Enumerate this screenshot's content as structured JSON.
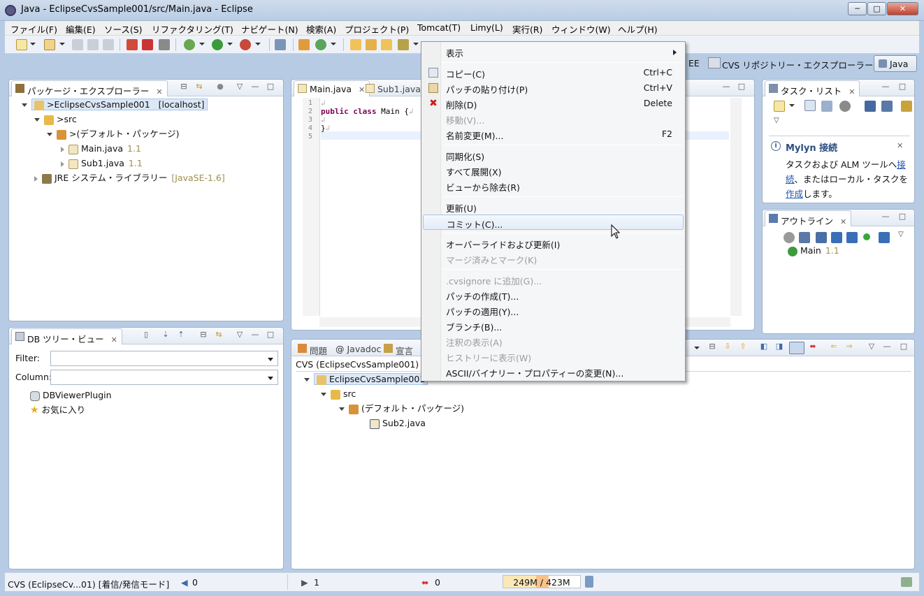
{
  "window": {
    "title": "Java - EclipseCvsSample001/src/Main.java - Eclipse",
    "min": "─",
    "max": "□",
    "close": "✕"
  },
  "menubar": [
    "ファイル(F)",
    "編集(E)",
    "ソース(S)",
    "リファクタリング(T)",
    "ナビゲート(N)",
    "検索(A)",
    "プロジェクト(P)",
    "Tomcat(T)",
    "Limy(L)",
    "実行(R)",
    "ウィンドウ(W)",
    "ヘルプ(H)"
  ],
  "perspectives": {
    "javaee": "EE",
    "cvs": "CVS リポジトリー・エクスプローラー",
    "java": "Java"
  },
  "package_explorer": {
    "tab": "パッケージ・エクスプローラー",
    "project": ">EclipseCvsSample001",
    "host": "[localhost]",
    "src": ">src",
    "default_pkg": ">(デフォルト・パッケージ)",
    "files": [
      {
        "name": "Main.java",
        "ver": "1.1"
      },
      {
        "name": "Sub1.java",
        "ver": "1.1"
      }
    ],
    "jre": "JRE システム・ライブラリー",
    "jre_ver": "[JavaSE-1.6]"
  },
  "editor": {
    "tabs": [
      "Main.java",
      "Sub1.java"
    ],
    "line_numbers": [
      "1",
      "2",
      "3",
      "4",
      "5"
    ],
    "code_kw1": "public",
    "code_kw2": "class",
    "code_rest": " Main {",
    "code_close": "}",
    "eol": "↲"
  },
  "db_tree": {
    "tab": "DB ツリー・ビュー",
    "filter_label": "Filter:",
    "column_label": "Column:",
    "items": [
      "DBViewerPlugin",
      "お気に入り"
    ]
  },
  "task_list": {
    "tab": "タスク・リスト",
    "mylyn_title": "Mylyn 接続",
    "mylyn_text1": "タスクおよび ALM ツールへ",
    "mylyn_link1": "接",
    "mylyn_link1b": "続",
    "mylyn_text2": "、またはローカル・タスクを",
    "mylyn_link2": "作成",
    "mylyn_text3": "します。"
  },
  "outline": {
    "tab": "アウトライン",
    "item": "Main",
    "ver": "1.1"
  },
  "bottom": {
    "tabs": [
      "問題",
      "Javadoc",
      "宣言"
    ],
    "header": "CVS (EclipseCvsSample001)",
    "project": "EclipseCvsSample001",
    "src": "src",
    "pkg": "(デフォルト・パッケージ)",
    "file": "Sub2.java"
  },
  "context_menu": {
    "items": [
      {
        "label": "表示",
        "short": "",
        "submenu": true
      },
      {
        "label": "コピー(C)",
        "short": "Ctrl+C"
      },
      {
        "label": "パッチの貼り付け(P)",
        "short": "Ctrl+V"
      },
      {
        "label": "削除(D)",
        "short": "Delete"
      },
      {
        "label": "移動(V)...",
        "short": "",
        "disabled": true
      },
      {
        "label": "名前変更(M)...",
        "short": "F2"
      },
      {
        "label": "同期化(S)",
        "short": ""
      },
      {
        "label": "すべて展開(X)",
        "short": ""
      },
      {
        "label": "ビューから除去(R)",
        "short": ""
      },
      {
        "label": "更新(U)",
        "short": ""
      },
      {
        "label": "コミット(C)...",
        "short": "",
        "hover": true
      },
      {
        "label": "オーバーライドおよび更新(I)",
        "short": ""
      },
      {
        "label": "マージ済みとマーク(K)",
        "short": "",
        "disabled": true
      },
      {
        "label": ".cvsignore に追加(G)...",
        "short": "",
        "disabled": true
      },
      {
        "label": "パッチの作成(T)...",
        "short": ""
      },
      {
        "label": "パッチの適用(Y)...",
        "short": ""
      },
      {
        "label": "ブランチ(B)...",
        "short": ""
      },
      {
        "label": "注釈の表示(A)",
        "short": "",
        "disabled": true
      },
      {
        "label": "ヒストリーに表示(W)",
        "short": "",
        "disabled": true
      },
      {
        "label": "ASCII/バイナリー・プロパティーの変更(N)...",
        "short": ""
      }
    ]
  },
  "statusbar": {
    "cvs": "CVS (EclipseCv...01) [着信/発信モード]",
    "incoming": "0",
    "outgoing": "1",
    "conflicts": "0",
    "heap": "249M / 423M",
    "heap_fraction": 0.589
  }
}
